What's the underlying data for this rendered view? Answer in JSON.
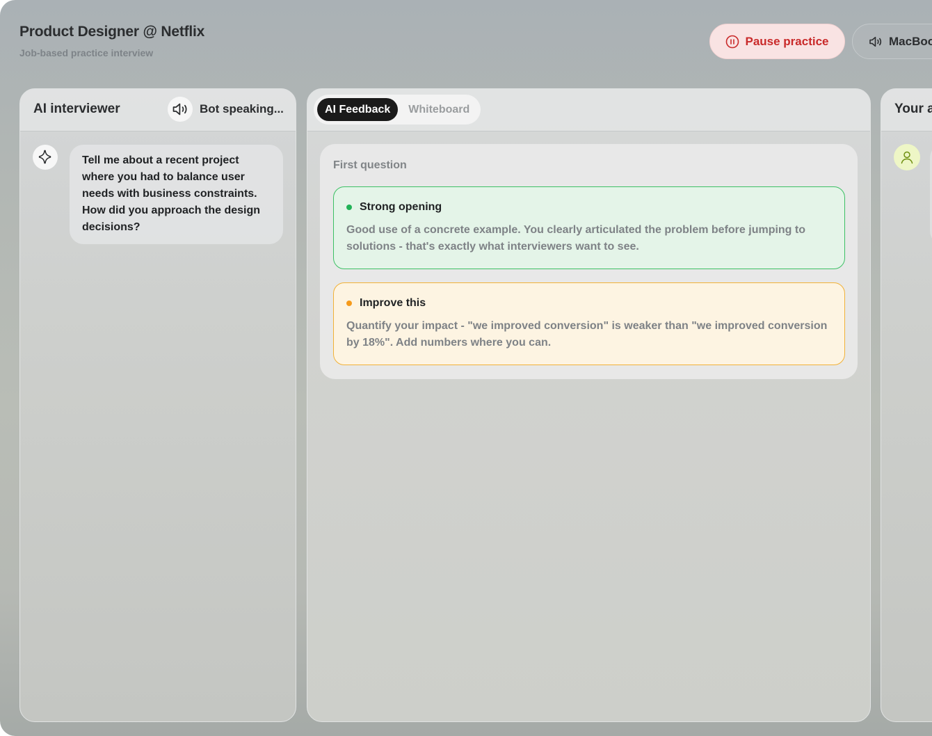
{
  "header": {
    "title": "Product Designer @ Netflix",
    "subtitle": "Job-based practice interview",
    "pause_label": "Pause practice",
    "device_label": "MacBook"
  },
  "left_panel": {
    "title": "AI interviewer",
    "status": "Bot speaking...",
    "message": "Tell me about a recent project where you had to balance user needs with business constraints. How did you approach the design decisions?"
  },
  "mid_panel": {
    "tabs": [
      {
        "label": "AI Feedback",
        "active": true
      },
      {
        "label": "Whiteboard",
        "active": false
      }
    ],
    "feedback": {
      "section_label": "First question",
      "notes": [
        {
          "title": "Strong opening",
          "text": "Good use of a concrete example. You clearly articulated the problem before jumping to solutions - that's exactly what interviewers want to see.",
          "kind": "positive",
          "color": "#22b257"
        },
        {
          "title": "Improve this",
          "text": "Quantify your impact - \"we improved conversion\" is weaker than \"we improved conversion by 18%\". Add numbers where you can.",
          "kind": "improvement",
          "color": "#f59a1b"
        }
      ]
    }
  },
  "right_panel": {
    "title": "Your a"
  },
  "icons": {
    "pause": "pause-circle-icon",
    "speaker": "speaker-icon",
    "sparkle": "sparkle-icon",
    "user": "user-icon"
  },
  "colors": {
    "pause_text": "#c92a2a",
    "positive_border": "#3cc064",
    "warning_border": "#f1b137",
    "active_tab": "#1a1a1a"
  }
}
